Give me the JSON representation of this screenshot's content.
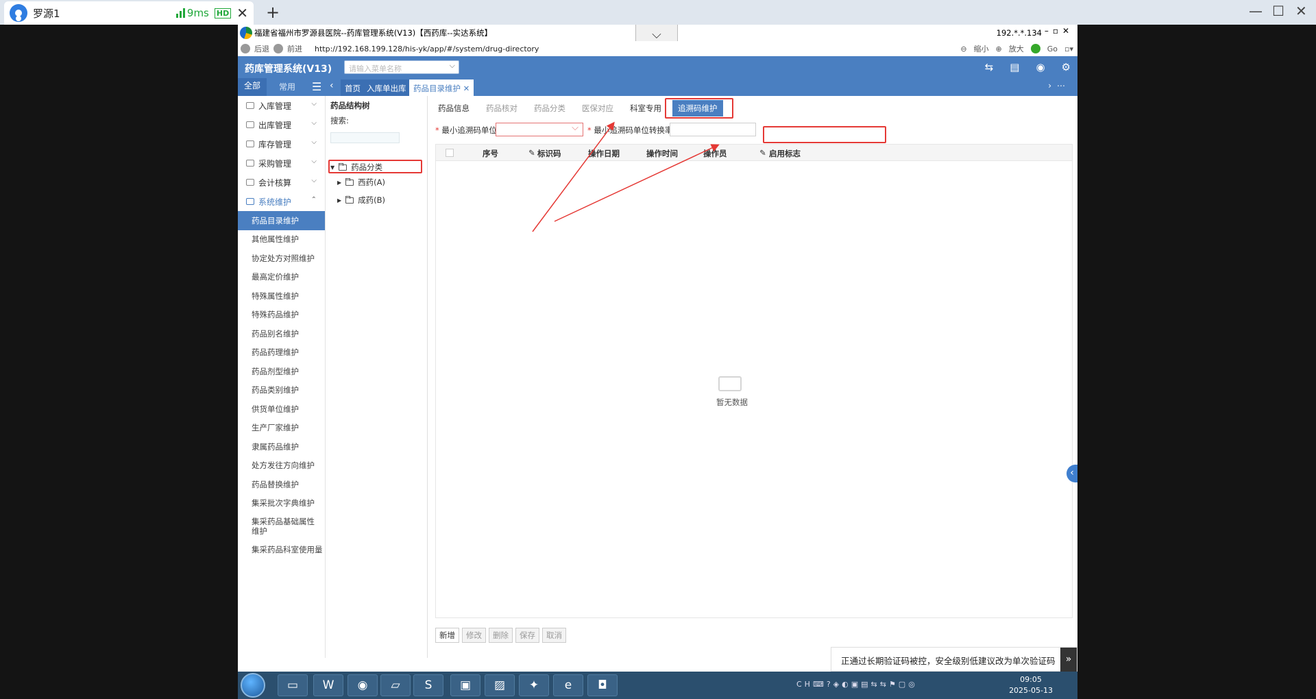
{
  "client": {
    "tab_name": "罗源1",
    "latency": "9ms",
    "quality_badge": "HD",
    "new_tab": "+",
    "close": "✕",
    "win_minimize": "—",
    "win_maximize": "☐",
    "win_close": "✕"
  },
  "ie": {
    "window_title": "福建省福州市罗源县医院--药库管理系统(V13)【西药库--实达系统】",
    "ip": "192.*.*.134",
    "back": "后退",
    "forward": "前进",
    "url": "http://192.168.199.128/his-yk/app/#/system/drug-directory",
    "zoom_out": "缩小",
    "zoom_in": "放大",
    "go": "Go"
  },
  "app": {
    "title": "药库管理系统(V13)",
    "menu_search_placeholder": "请输入菜单名称",
    "nav_all": "全部",
    "nav_common": "常用",
    "page_tabs": [
      "首页",
      "入库单出库",
      "药品目录维护"
    ]
  },
  "sidebar": {
    "groups": [
      "入库管理",
      "出库管理",
      "库存管理",
      "采购管理",
      "会计核算",
      "系统维护"
    ],
    "items": [
      "药品目录维护",
      "其他属性维护",
      "协定处方对照维护",
      "最高定价维护",
      "特殊属性维护",
      "特殊药品维护",
      "药品别名维护",
      "药品药理维护",
      "药品剂型维护",
      "药品类别维护",
      "供货单位维护",
      "生产厂家维护",
      "隶属药品维护",
      "处方发往方向维护",
      "药品替换维护",
      "集采批次字典维护",
      "集采药品基础属性维护",
      "集采药品科室使用量"
    ]
  },
  "tree": {
    "header": "药品结构树",
    "search_label": "搜索:",
    "root": "药品分类",
    "children": [
      "西药(A)",
      "成药(B)"
    ]
  },
  "main": {
    "sub_tabs": [
      "药品信息",
      "药品核对",
      "药品分类",
      "医保对应",
      "科室专用",
      "追溯码维护"
    ],
    "field1_label": "最小追溯码单位:",
    "field2_label": "最小追溯码单位转换率:",
    "columns": [
      "序号",
      "标识码",
      "操作日期",
      "操作时间",
      "操作员",
      "启用标志"
    ],
    "empty_text": "暂无数据",
    "buttons": [
      "新增",
      "修改",
      "删除",
      "保存",
      "取消"
    ]
  },
  "notification": "正通过长期验证码被控，安全级别低建议改为单次验证码",
  "clock": {
    "time": "09:05",
    "date": "2025-05-13"
  },
  "colors": {
    "accent": "#4a7fc1",
    "annotation": "#e53935"
  }
}
